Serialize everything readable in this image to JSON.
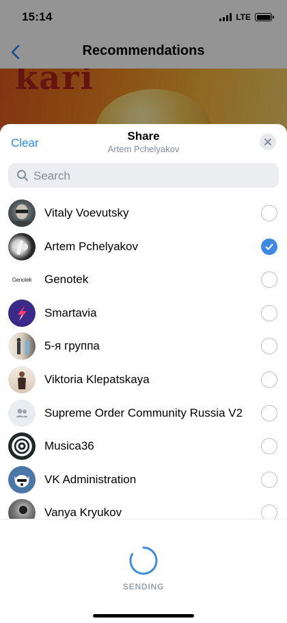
{
  "status_bar": {
    "time": "15:14",
    "network": "LTE",
    "icons": [
      "signal-icon",
      "battery-icon"
    ]
  },
  "nav": {
    "title": "Recommendations",
    "back_icon": "chevron-left-icon"
  },
  "cover": {
    "text": "kari"
  },
  "share_sheet": {
    "clear_label": "Clear",
    "title": "Share",
    "subtitle": "Artem Pchelyakov",
    "close_icon": "close-icon",
    "search": {
      "placeholder": "Search",
      "icon": "search-icon"
    },
    "contacts": [
      {
        "name": "Vitaly Voevutsky",
        "selected": false
      },
      {
        "name": "Artem Pchelyakov",
        "selected": true
      },
      {
        "name": "Genotek",
        "selected": false,
        "avatar_text": "Genotek"
      },
      {
        "name": "Smartavia",
        "selected": false
      },
      {
        "name": "5-я группа",
        "selected": false
      },
      {
        "name": "Viktoria Klepatskaya",
        "selected": false
      },
      {
        "name": "Supreme Order Community Russia V2",
        "selected": false
      },
      {
        "name": "Musica36",
        "selected": false
      },
      {
        "name": "VK Administration",
        "selected": false
      },
      {
        "name": "Vanya Kryukov",
        "selected": false
      }
    ],
    "sending_label": "SENDING"
  },
  "colors": {
    "accent": "#2787f5",
    "checkbox_on": "#3f8ae0",
    "secondary_text": "#818c99"
  }
}
